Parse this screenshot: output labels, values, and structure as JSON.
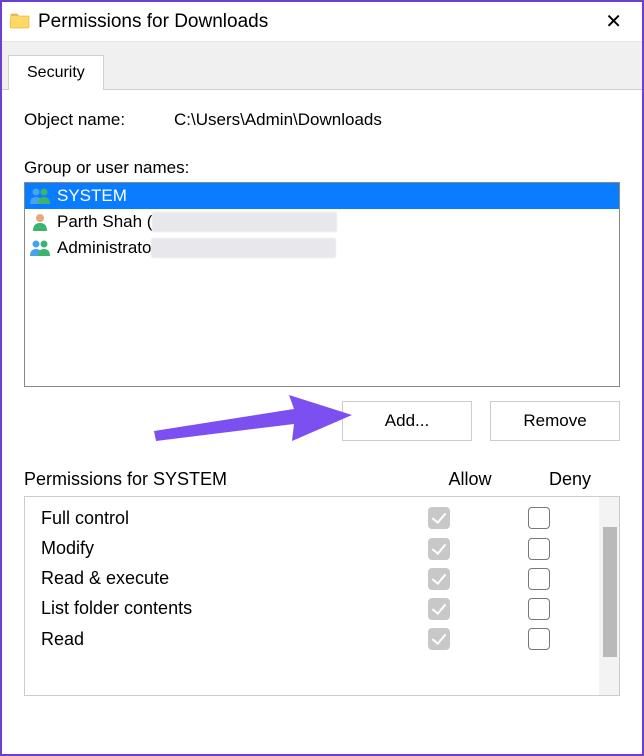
{
  "window": {
    "title": "Permissions for Downloads"
  },
  "tab": {
    "label": "Security"
  },
  "object": {
    "label": "Object name:",
    "value": "C:\\Users\\Admin\\Downloads"
  },
  "group_label": "Group or user names:",
  "users": [
    {
      "name": "SYSTEM",
      "icon": "people-icon",
      "selected": true,
      "blurred": false
    },
    {
      "name": "Parth Shah (",
      "icon": "person-icon",
      "selected": false,
      "blurred": true
    },
    {
      "name": "Administrato",
      "icon": "people-icon",
      "selected": false,
      "blurred": true
    }
  ],
  "buttons": {
    "add": "Add...",
    "remove": "Remove"
  },
  "perm_header": {
    "title": "Permissions for SYSTEM",
    "allow": "Allow",
    "deny": "Deny"
  },
  "permissions": [
    {
      "name": "Full control",
      "allow": true,
      "deny": false
    },
    {
      "name": "Modify",
      "allow": true,
      "deny": false
    },
    {
      "name": "Read & execute",
      "allow": true,
      "deny": false
    },
    {
      "name": "List folder contents",
      "allow": true,
      "deny": false
    },
    {
      "name": "Read",
      "allow": true,
      "deny": false
    }
  ]
}
